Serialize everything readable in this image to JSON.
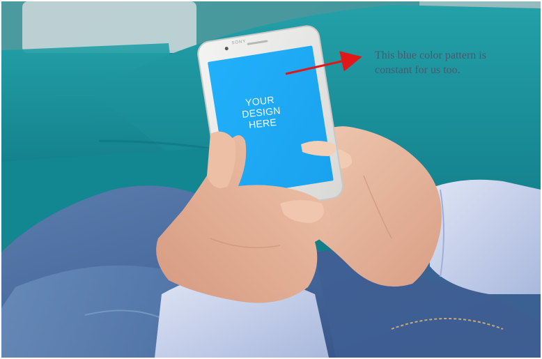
{
  "phone": {
    "brand": "SONY",
    "screen_lines": [
      "YOUR",
      "DESIGN",
      "HERE"
    ],
    "screen_color": "#1fa9f5"
  },
  "annotation": {
    "line1": "This blue color pattern is",
    "line2": "constant for us too.",
    "arrow_color": "#e01818"
  },
  "colors": {
    "couch_teal": "#1a8c96",
    "denim": "#4a6f9e",
    "shirt": "#c5cfe8",
    "skin": "#e7b9a0"
  }
}
